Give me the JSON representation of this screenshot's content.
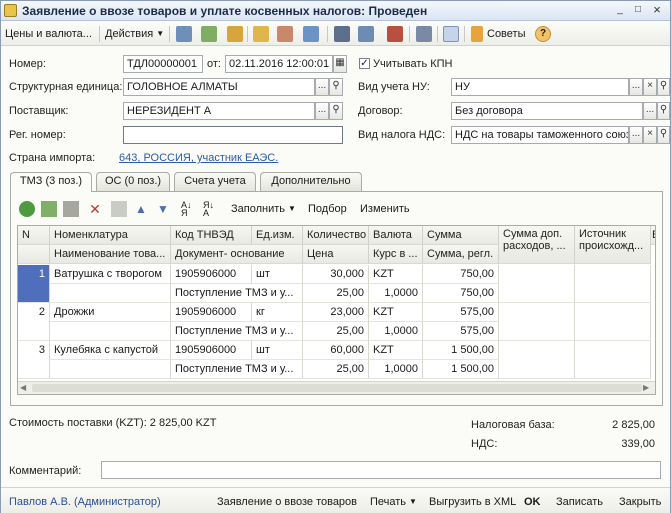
{
  "window": {
    "title": "Заявление о ввозе товаров и уплате косвенных налогов: Проведен",
    "minimize": "_",
    "maximize": "□",
    "close": "×"
  },
  "toolbar": {
    "prices_label": "Цены и валюта...",
    "actions_label": "Действия",
    "advice_label": "Советы",
    "help_icon": "?"
  },
  "form": {
    "number_label": "Номер:",
    "number_value": "ТДЛ00000001",
    "date_label": "от:",
    "date_value": "02.11.2016 12:00:01",
    "kpn_label": "Учитывать КПН",
    "kpn_checked": "✓",
    "unit_label": "Структурная единица:",
    "unit_value": "ГОЛОВНОЕ АЛМАТЫ",
    "nu_label": "Вид учета НУ:",
    "nu_value": "НУ",
    "supplier_label": "Поставщик:",
    "supplier_value": "НЕРЕЗИДЕНТ А",
    "contract_label": "Договор:",
    "contract_value": "Без договора",
    "regnum_label": "Рег. номер:",
    "regnum_value": "",
    "vat_label": "Вид налога НДС:",
    "vat_value": "НДС на товары таможенного союза",
    "country_label": "Страна импорта:",
    "country_value": "643, РОССИЯ, участник ЕАЭС.",
    "dots": "...",
    "clear": "×",
    "search": "🔍"
  },
  "tabs": [
    {
      "label": "ТМЗ (3 поз.)"
    },
    {
      "label": "ОС (0 поз.)"
    },
    {
      "label": "Счета учета"
    },
    {
      "label": "Дополнительно"
    }
  ],
  "table_toolbar": {
    "fill_label": "Заполнить",
    "select_label": "Подбор",
    "change_label": "Изменить"
  },
  "table": {
    "headers_top": [
      "N",
      "Номенклатура",
      "Код ТНВЭД",
      "Ед.изм.",
      "Количество",
      "Валюта",
      "Сумма",
      "Сумма доп. расходов, ...",
      "Источник происхожд...",
      "Б"
    ],
    "headers_bottom": [
      "",
      "Наименование това...",
      "Документ- основание",
      "",
      "Цена",
      "Курс в ...",
      "Сумма, регл.",
      "",
      "",
      ""
    ],
    "rows": [
      {
        "n": "1",
        "name": "Ватрушка с творогом",
        "code": "1905906000",
        "doc": "Поступление ТМЗ и у...",
        "unit": "шт",
        "qty": "30,000",
        "price": "25,00",
        "currency": "KZT",
        "rate": "1,0000",
        "sum": "750,00",
        "sum_reg": "750,00"
      },
      {
        "n": "2",
        "name": "Дрожжи",
        "code": "1905906000",
        "doc": "Поступление ТМЗ и у...",
        "unit": "кг",
        "qty": "23,000",
        "price": "25,00",
        "currency": "KZT",
        "rate": "1,0000",
        "sum": "575,00",
        "sum_reg": "575,00"
      },
      {
        "n": "3",
        "name": "Кулебяка с капустой",
        "code": "1905906000",
        "doc": "Поступление ТМЗ и у...",
        "unit": "шт",
        "qty": "60,000",
        "price": "25,00",
        "currency": "KZT",
        "rate": "1,0000",
        "sum": "1 500,00",
        "sum_reg": "1 500,00"
      }
    ]
  },
  "totals": {
    "cost_label": "Стоимость поставки (KZT): 2 825,00 KZT",
    "tax_base_label": "Налоговая база:",
    "tax_base_value": "2 825,00",
    "vat_label": "НДС:",
    "vat_value": "339,00"
  },
  "comment": {
    "label": "Комментарий:",
    "value": ""
  },
  "bottom": {
    "user": "Павлов А.В. (Администратор)",
    "statement": "Заявление о ввозе товаров",
    "print": "Печать",
    "export_xml": "Выгрузить в XML",
    "ok": "OK",
    "save": "Записать",
    "close": "Закрыть"
  },
  "colors": {
    "accent": "#4f6fbd",
    "link": "#2a5ca8",
    "title_bg": "#dbe5f3"
  }
}
